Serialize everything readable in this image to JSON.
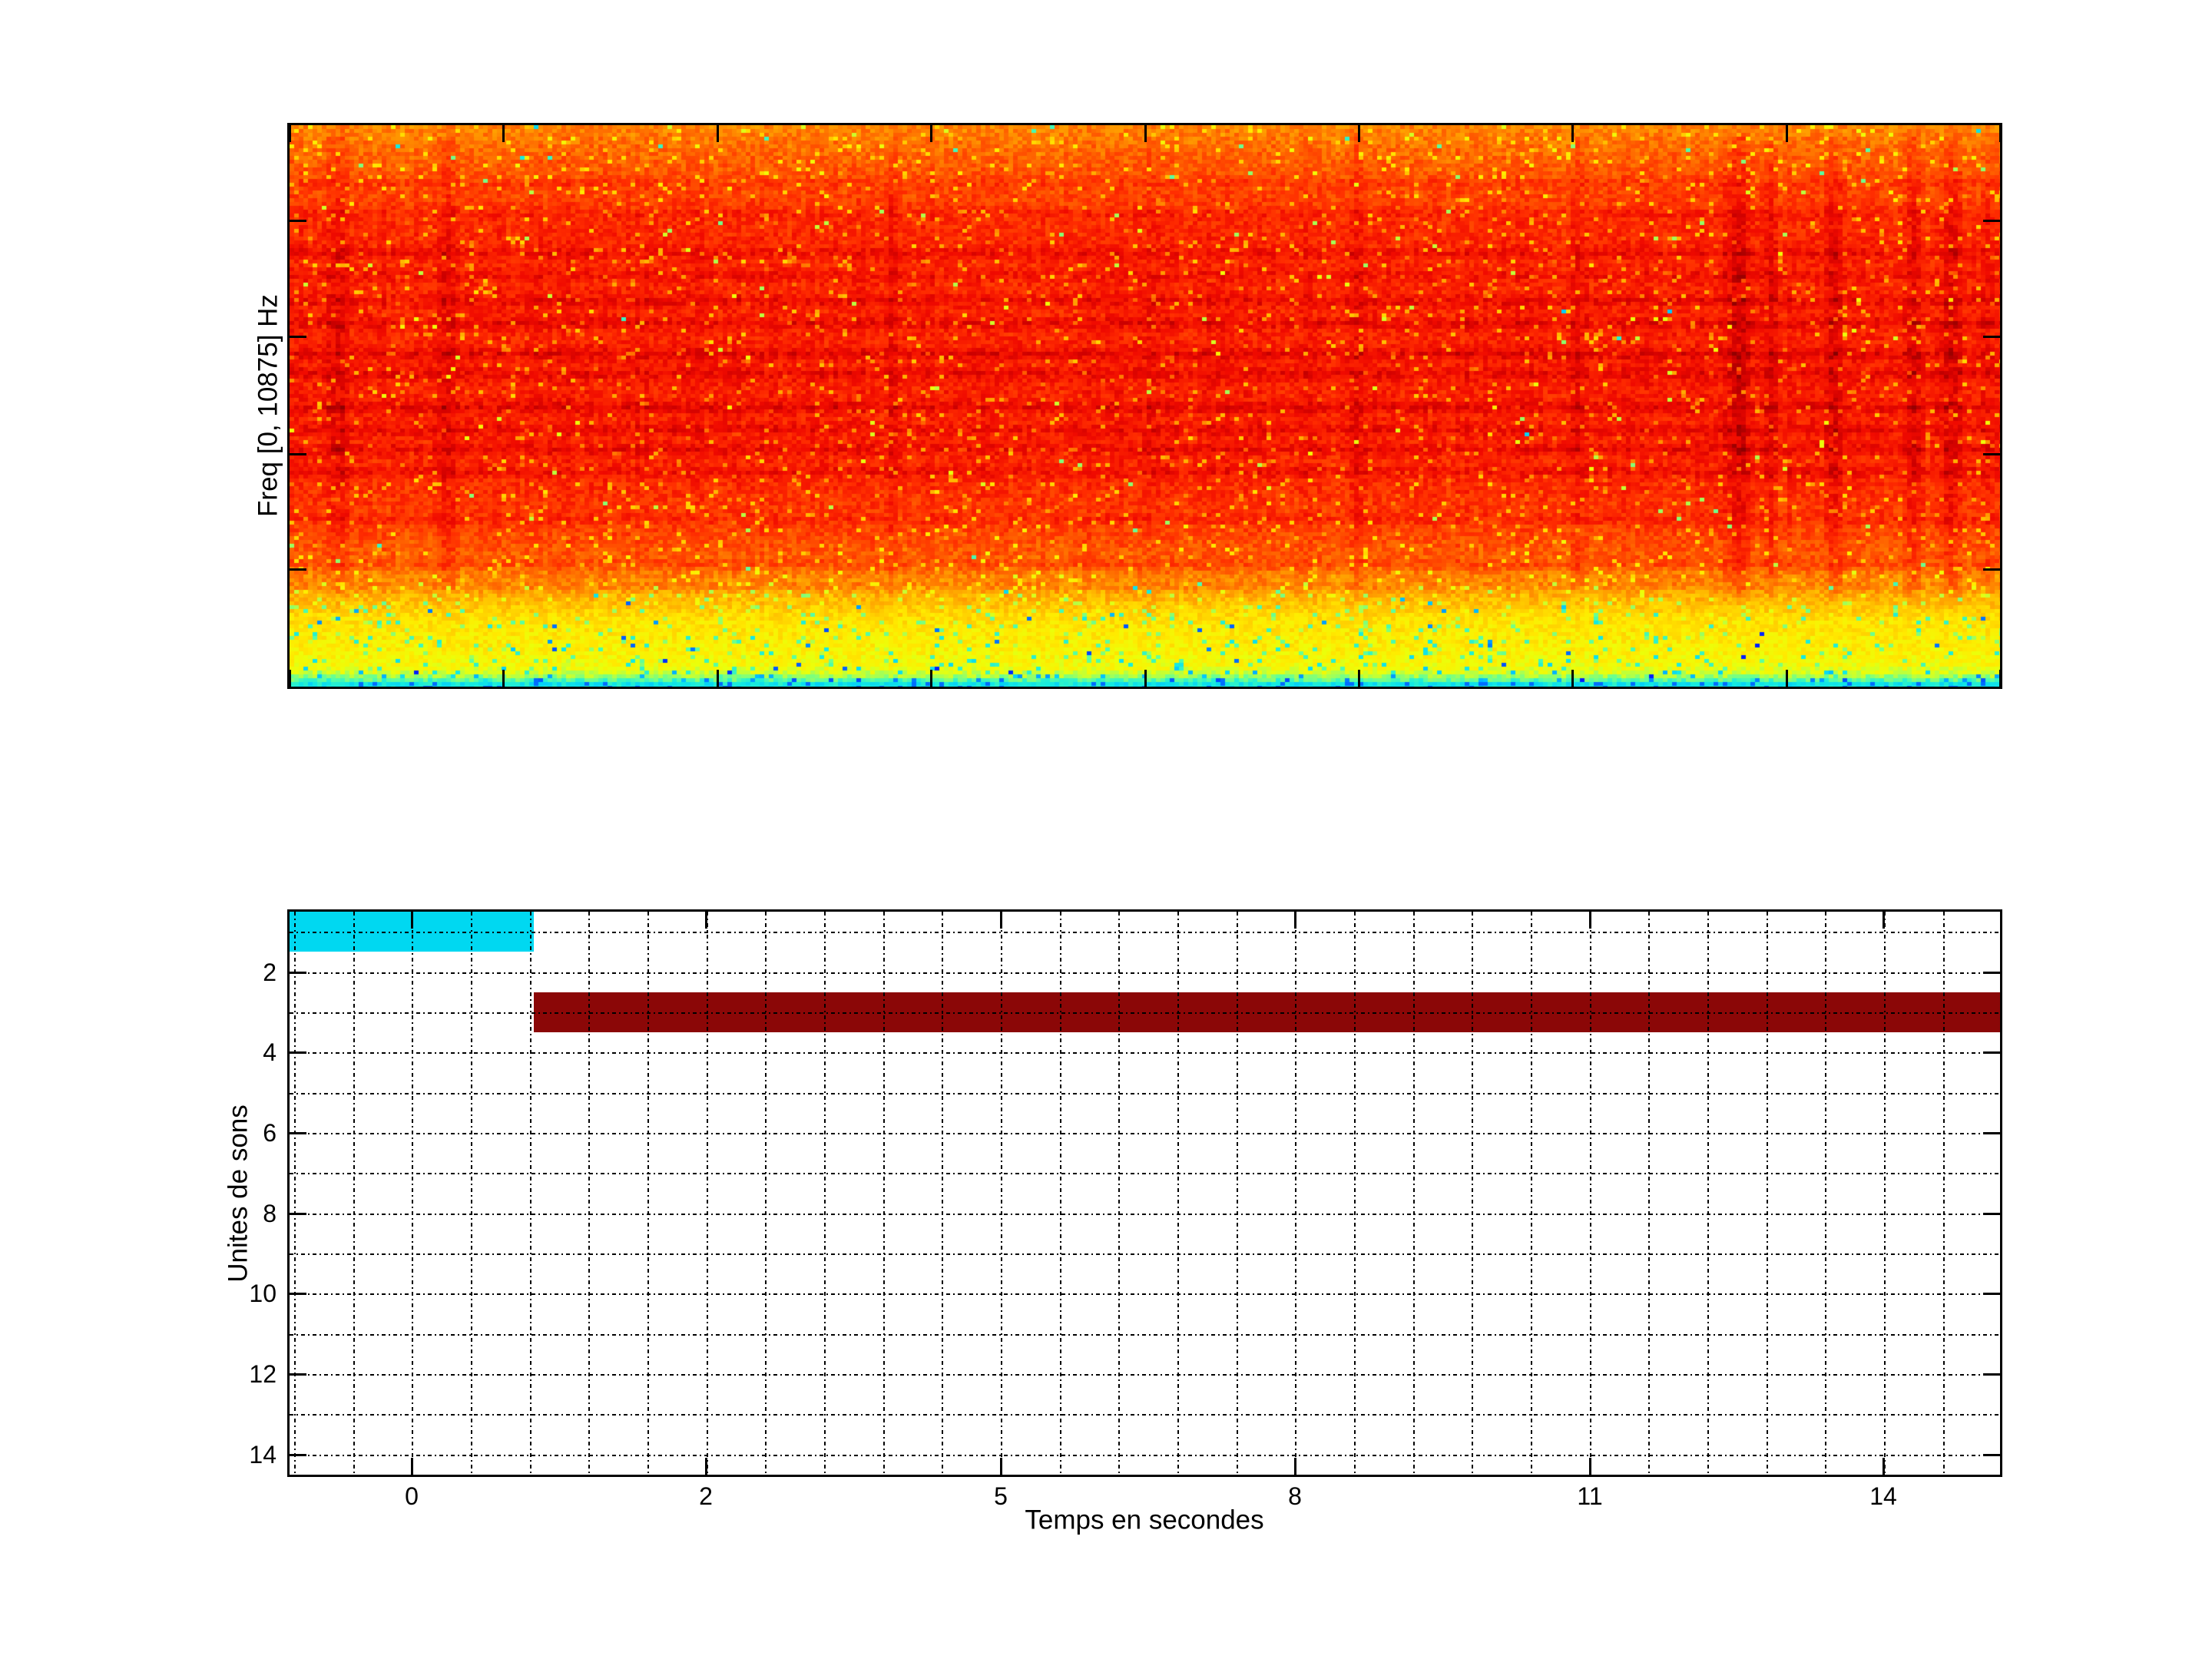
{
  "figure": {
    "background": "#ffffff",
    "axis_color": "#000000",
    "grid_color": "#000000",
    "text_color": "#000000"
  },
  "chart_data": [
    {
      "type": "heatmap",
      "name": "spectrogram",
      "ylabel": "Freq [0, 10875] Hz",
      "xlabel": "",
      "freq_range_hz": [
        0,
        10875
      ],
      "colormap": "jet",
      "legend": "none",
      "grid": false,
      "x_tick_fracs": [
        0,
        0.125,
        0.25,
        0.375,
        0.5,
        0.625,
        0.75,
        0.875,
        1
      ],
      "y_tick_fracs": [
        0.17,
        0.376,
        0.586,
        0.791
      ],
      "seed": 42,
      "base_profile": [
        [
          0,
          0.71
        ],
        [
          0.05,
          0.75
        ],
        [
          0.18,
          0.83
        ],
        [
          0.45,
          0.845
        ],
        [
          0.6,
          0.835
        ],
        [
          0.7,
          0.805
        ],
        [
          0.78,
          0.75
        ],
        [
          0.83,
          0.66
        ],
        [
          0.88,
          0.575
        ],
        [
          0.93,
          0.545
        ],
        [
          0.962,
          0.52
        ],
        [
          0.975,
          0.47
        ],
        [
          0.988,
          0.36
        ],
        [
          1,
          0.33
        ]
      ],
      "dark_bands": [
        [
          0.1,
          0.03
        ],
        [
          0.155,
          0.03
        ],
        [
          0.225,
          0.045
        ],
        [
          0.265,
          0.035
        ],
        [
          0.31,
          0.05
        ],
        [
          0.35,
          0.05
        ],
        [
          0.405,
          0.055
        ],
        [
          0.44,
          0.045
        ],
        [
          0.5,
          0.055
        ],
        [
          0.54,
          0.045
        ],
        [
          0.575,
          0.05
        ],
        [
          0.615,
          0.045
        ],
        [
          0.7,
          0.03
        ],
        [
          0.78,
          0.035
        ],
        [
          0.82,
          0.03
        ]
      ],
      "dark_streaks": [
        [
          0.027,
          0.05,
          2
        ],
        [
          0.091,
          0.045,
          2
        ],
        [
          0.16,
          0.03,
          1
        ],
        [
          0.35,
          0.03,
          1
        ],
        [
          0.5,
          0.025,
          1
        ],
        [
          0.62,
          0.03,
          1
        ],
        [
          0.75,
          0.025,
          1
        ],
        [
          0.845,
          0.07,
          3
        ],
        [
          0.862,
          0.04,
          1
        ],
        [
          0.9,
          0.05,
          2
        ],
        [
          0.945,
          0.04,
          2
        ],
        [
          0.968,
          0.05,
          2
        ],
        [
          0.99,
          0.03,
          1
        ]
      ]
    },
    {
      "type": "bar",
      "orientation": "horizontal",
      "name": "sound-units-timeline",
      "ylabel": "Unites de sons",
      "xlabel": "Temps en secondes",
      "grid": true,
      "y_range": [
        0.5,
        14.5
      ],
      "x_tick_labels": [
        "0",
        "2",
        "5",
        "8",
        "11",
        "14"
      ],
      "x_tick_fracs": [
        0.0712,
        0.2432,
        0.4157,
        0.5876,
        0.76,
        0.9319
      ],
      "y_tick_labels": [
        "2",
        "4",
        "6",
        "8",
        "10",
        "12",
        "14"
      ],
      "y_tick_values": [
        2,
        4,
        6,
        8,
        10,
        12,
        14
      ],
      "grid_y_values": [
        1,
        2,
        3,
        4,
        5,
        6,
        7,
        8,
        9,
        10,
        11,
        12,
        13,
        14
      ],
      "grid_x_start_frac": 0.0027,
      "grid_x_step_frac": 0.034428,
      "grid_x_count": 30,
      "bars": [
        {
          "unit": 1,
          "t_start_s": -0.83,
          "t_end_s": 0.84,
          "x_start_frac": 0,
          "x_end_frac": 0.1429,
          "color": "#00d8f1"
        },
        {
          "unit": 3,
          "t_start_s": 0.84,
          "t_end_s": 15.2,
          "x_start_frac": 0.1429,
          "x_end_frac": 1,
          "color": "#8b0707"
        }
      ]
    }
  ]
}
